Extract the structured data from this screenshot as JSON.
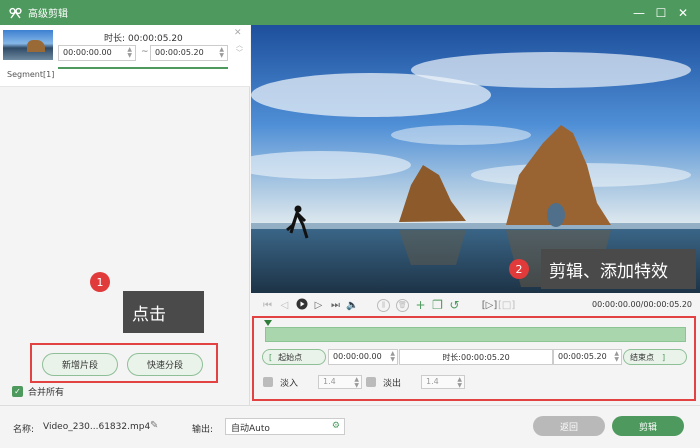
{
  "window": {
    "title": "高级剪辑",
    "controls": [
      "—",
      "☐",
      "✕"
    ]
  },
  "segment": {
    "label": "Segment[1]",
    "duration_label": "时长:",
    "duration_value": "00:00:05.20",
    "start": "00:00:00.00",
    "end": "00:00:05.20",
    "separator": "~"
  },
  "left_buttons": {
    "new_segment": "新增片段",
    "quick_split": "快速分段"
  },
  "merge_all": "合并所有",
  "annotations": {
    "callout1": {
      "number": "1",
      "text": "点击"
    },
    "callout2": {
      "number": "2",
      "text": "剪辑、添加特效"
    }
  },
  "player": {
    "timecode": "00:00:00.00/00:00:05.20"
  },
  "trim": {
    "start_point_label": "起始点",
    "start_value": "00:00:00.00",
    "duration_label": "时长:",
    "duration_value": "00:00:05.20",
    "end_value": "00:00:05.20",
    "end_point_label": "结束点"
  },
  "fade": {
    "fade_in_label": "淡入",
    "fade_in_value": "1.4",
    "fade_out_label": "淡出",
    "fade_out_value": "1.4"
  },
  "bottom": {
    "name_label": "名称:",
    "name_value": "Video_230...61832.mp4",
    "output_label": "输出:",
    "output_value": "自动Auto",
    "back_button": "返回",
    "cut_button": "剪辑"
  },
  "colors": {
    "brand_green": "#4e9a5e",
    "annotation_red": "#e24242"
  }
}
